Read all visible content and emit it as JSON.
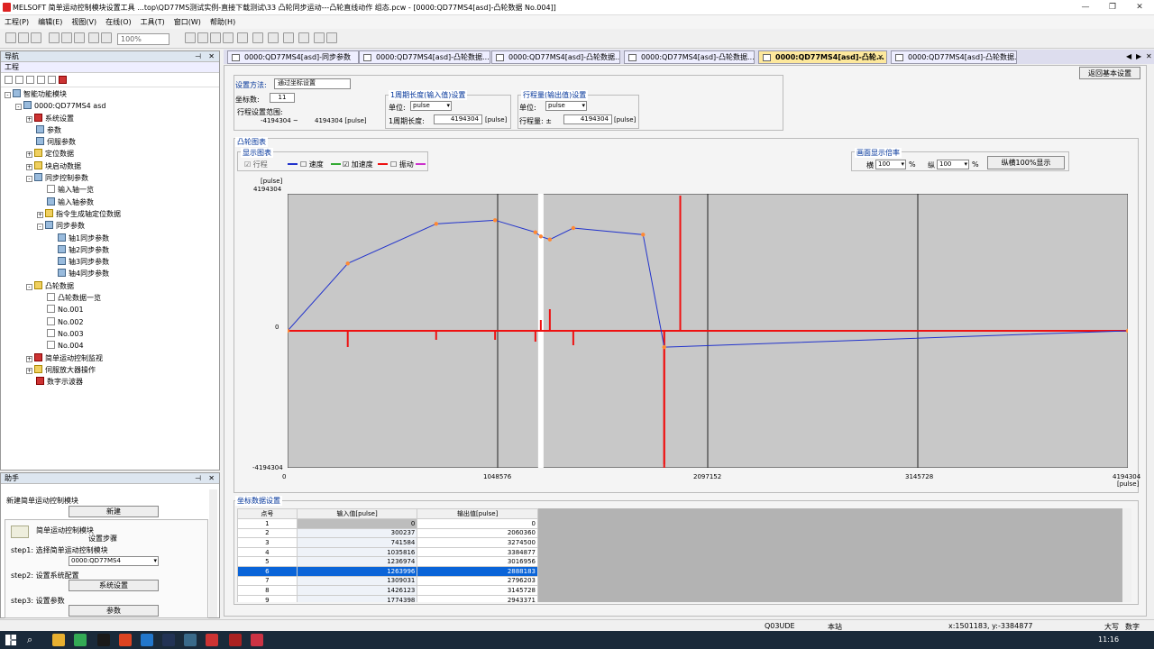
{
  "window": {
    "title": "MELSOFT 简单运动控制模块设置工具 ...top\\QD77MS测试实例-直接下载测试\\33 凸轮同步运动---凸轮直线动作 组态.pcw - [0000:QD77MS4[asd]-凸轮数据 No.004]]"
  },
  "menu": [
    "工程(P)",
    "编辑(E)",
    "视图(V)",
    "在线(O)",
    "工具(T)",
    "窗口(W)",
    "帮助(H)"
  ],
  "toolbar": {
    "zoom": "100%"
  },
  "nav": {
    "title": "导航",
    "project_label": "工程",
    "items": [
      {
        "label": "智能功能模块",
        "depth": 0,
        "exp": "-",
        "icon": "blu"
      },
      {
        "label": "0000:QD77MS4 asd",
        "depth": 1,
        "exp": "-",
        "icon": "blu"
      },
      {
        "label": "系统设置",
        "depth": 2,
        "exp": "+",
        "icon": "red"
      },
      {
        "label": "参数",
        "depth": 2,
        "exp": "",
        "icon": "blu"
      },
      {
        "label": "伺服参数",
        "depth": 2,
        "exp": "",
        "icon": "blu"
      },
      {
        "label": "定位数据",
        "depth": 2,
        "exp": "+",
        "icon": "yel"
      },
      {
        "label": "块启动数据",
        "depth": 2,
        "exp": "+",
        "icon": "yel"
      },
      {
        "label": "同步控制参数",
        "depth": 2,
        "exp": "-",
        "icon": "blu"
      },
      {
        "label": "输入轴一览",
        "depth": 3,
        "exp": "",
        "icon": "white"
      },
      {
        "label": "输入轴参数",
        "depth": 3,
        "exp": "",
        "icon": "blu"
      },
      {
        "label": "指令生成轴定位数据",
        "depth": 3,
        "exp": "+",
        "icon": "yel"
      },
      {
        "label": "同步参数",
        "depth": 3,
        "exp": "-",
        "icon": "blu"
      },
      {
        "label": "轴1同步参数",
        "depth": 4,
        "exp": "",
        "icon": "blu"
      },
      {
        "label": "轴2同步参数",
        "depth": 4,
        "exp": "",
        "icon": "blu"
      },
      {
        "label": "轴3同步参数",
        "depth": 4,
        "exp": "",
        "icon": "blu"
      },
      {
        "label": "轴4同步参数",
        "depth": 4,
        "exp": "",
        "icon": "blu"
      },
      {
        "label": "凸轮数据",
        "depth": 2,
        "exp": "-",
        "icon": "yel"
      },
      {
        "label": "凸轮数据一览",
        "depth": 3,
        "exp": "",
        "icon": "white"
      },
      {
        "label": "No.001",
        "depth": 3,
        "exp": "",
        "icon": "white"
      },
      {
        "label": "No.002",
        "depth": 3,
        "exp": "",
        "icon": "white"
      },
      {
        "label": "No.003",
        "depth": 3,
        "exp": "",
        "icon": "white"
      },
      {
        "label": "No.004",
        "depth": 3,
        "exp": "",
        "icon": "white"
      },
      {
        "label": "简单运动控制监视",
        "depth": 2,
        "exp": "+",
        "icon": "red"
      },
      {
        "label": "伺服放大器操作",
        "depth": 2,
        "exp": "+",
        "icon": "yel"
      },
      {
        "label": "数字示波器",
        "depth": 2,
        "exp": "",
        "icon": "red"
      }
    ]
  },
  "helper": {
    "title": "助手",
    "new_module": "新建简单运动控制模块",
    "new_btn": "新建",
    "box_title": "简单运动控制模块",
    "box_sub": "设置步骤",
    "step1": "step1: 选择简单运动控制模块",
    "module_sel": "0000:QD77MS4",
    "step2": "step2: 设置系统配置",
    "sys_btn": "系统设置",
    "step3": "step3: 设置参数",
    "param_btn": "参数"
  },
  "tabs": [
    "0000:QD77MS4[asd]-同步参数",
    "0000:QD77MS4[asd]-凸轮数据...",
    "0000:QD77MS4[asd]-凸轮数据...",
    "0000:QD77MS4[asd]-凸轮数据...",
    "0000:QD77MS4[asd]-凸轮...",
    "0000:QD77MS4[asd]-凸轮数据..."
  ],
  "active_tab": 4,
  "settings": {
    "method_label": "设置方法:",
    "method_value": "通过坐标设置",
    "coord_label": "坐标数:",
    "coord_value": "11",
    "range_label": "行程设置范围:",
    "range_min": "-4194304 ~",
    "range_max": "4194304 [pulse]",
    "cycle_group": "1周期长度(输入值)设置",
    "unit_label": "单位:",
    "unit_value": "pulse",
    "cycle_label": "1周期长度:",
    "cycle_value": "4194304",
    "cycle_unit": "[pulse]",
    "stroke_group": "行程量(输出值)设置",
    "stroke_unit_label": "单位:",
    "stroke_unit_value": "pulse",
    "stroke_label": "行程量: ±",
    "stroke_value": "4194304",
    "stroke_unit": "[pulse]",
    "back_btn": "返回基本设置"
  },
  "cam": {
    "section": "凸轮图表",
    "display_group": "显示图表",
    "stroke": "行程",
    "speed": "速度",
    "accel": "加速度",
    "jerk": "振动",
    "ratio_group": "画面显示倍率",
    "h_label": "横",
    "h_val": "100",
    "pct": "%",
    "v_label": "纵",
    "v_val": "100",
    "pct2": "%",
    "full_btn": "纵横100%显示",
    "y_unit": "[pulse]",
    "y_top": "4194304",
    "y_zero": "0",
    "y_bottom": "-4194304",
    "x_ticks": [
      "0",
      "1048576",
      "2097152",
      "3145728",
      "4194304"
    ],
    "x_unit": "[pulse]",
    "colors": {
      "stroke": "#2233cc",
      "accel": "#ee1111",
      "point": "#ff8833"
    }
  },
  "chart_data": {
    "type": "line",
    "title": "",
    "xlabel": "[pulse]",
    "ylabel": "[pulse]",
    "xlim": [
      0,
      4194304
    ],
    "ylim": [
      -4194304,
      4194304
    ],
    "x": [
      0,
      300237,
      741584,
      1035816,
      1236974,
      1263996,
      1309031,
      1426123,
      1774398,
      1880000,
      4194304
    ],
    "series": [
      {
        "name": "行程",
        "values": [
          0,
          2060360,
          3274500,
          3384877,
          3016956,
          2888183,
          2796203,
          3145728,
          2943371,
          -500000,
          0
        ]
      }
    ]
  },
  "coords": {
    "section": "坐标数据设置",
    "headers": [
      "点号",
      "输入值[pulse]",
      "输出值[pulse]"
    ],
    "rows": [
      [
        "1",
        "0",
        "0"
      ],
      [
        "2",
        "300237",
        "2060360"
      ],
      [
        "3",
        "741584",
        "3274500"
      ],
      [
        "4",
        "1035816",
        "3384877"
      ],
      [
        "5",
        "1236974",
        "3016956"
      ],
      [
        "6",
        "1263996",
        "2888183"
      ],
      [
        "7",
        "1309031",
        "2796203"
      ],
      [
        "8",
        "1426123",
        "3145728"
      ],
      [
        "9",
        "1774398",
        "2943371"
      ]
    ],
    "selected": 5
  },
  "status": {
    "cpu": "Q03UDE",
    "station": "本站",
    "coord": "x:1501183, y:-3384877",
    "caps": "大写",
    "num": "数字"
  },
  "taskbar": {
    "time": "11:16"
  }
}
